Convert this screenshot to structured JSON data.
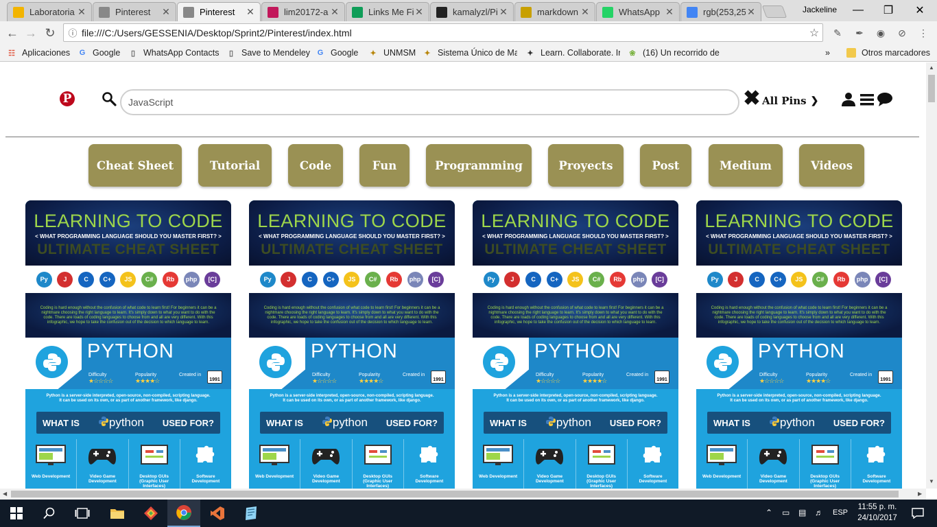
{
  "browser": {
    "tabs": [
      {
        "label": "Laboratoria",
        "icon": "laboratoria-icon",
        "color": "#f2b400"
      },
      {
        "label": "Pinterest",
        "icon": "page-icon",
        "color": "#888888"
      },
      {
        "label": "Pinterest",
        "icon": "page-icon",
        "color": "#888888",
        "active": true
      },
      {
        "label": "lim20172-a",
        "icon": "slack-icon",
        "color": "#c2185b"
      },
      {
        "label": "Links Me Fi",
        "icon": "sheets-icon",
        "color": "#0f9d58"
      },
      {
        "label": "kamalyzl/Pi",
        "icon": "github-icon",
        "color": "#222222"
      },
      {
        "label": "markdown",
        "icon": "markdown-icon",
        "color": "#c8a000"
      },
      {
        "label": "WhatsApp",
        "icon": "whatsapp-icon",
        "color": "#25d366"
      },
      {
        "label": "rgb(253,25",
        "icon": "google-icon",
        "color": "#4285f4"
      }
    ],
    "profile_name": "Jackeline",
    "url": "file:///C:/Users/GESSENIA/Desktop/Sprint2/Pinterest/index.html",
    "bookmarks": [
      {
        "label": "Aplicaciones",
        "icon": "apps-grid-icon"
      },
      {
        "label": "Google",
        "icon": "google-icon"
      },
      {
        "label": "WhatsApp Contacts",
        "icon": "page-icon"
      },
      {
        "label": "Save to Mendeley",
        "icon": "page-icon"
      },
      {
        "label": "Google",
        "icon": "google-icon"
      },
      {
        "label": "UNMSM",
        "icon": "unmsm-icon"
      },
      {
        "label": "Sistema Único de Ma",
        "icon": "unmsm-icon"
      },
      {
        "label": "Learn. Collaborate. In",
        "icon": "learn-icon"
      },
      {
        "label": "(16) Un recorrido de",
        "icon": "leaf-icon"
      }
    ],
    "bookmarks_more": "»",
    "other_bookmarks": "Otros marcadores"
  },
  "page": {
    "search_value": "JavaScript",
    "filter_label": "All Pins",
    "categories": [
      "Cheat Sheet",
      "Tutorial",
      "Code",
      "Fun",
      "Programming",
      "Proyects",
      "Post",
      "Medium",
      "Videos"
    ],
    "pin": {
      "title1": "LEARNING TO CODE",
      "title2": "< WHAT PROGRAMMING LANGUAGE SHOULD YOU MASTER FIRST? >",
      "title3": "ULTIMATE CHEAT SHEET",
      "languages": [
        {
          "name": "python",
          "label": "Py",
          "color": "#1e88c9"
        },
        {
          "name": "java",
          "label": "J",
          "color": "#d32f2f"
        },
        {
          "name": "c",
          "label": "C",
          "color": "#1565c0"
        },
        {
          "name": "cpp",
          "label": "C+",
          "color": "#1565c0"
        },
        {
          "name": "javascript",
          "label": "JS",
          "color": "#f4c21b"
        },
        {
          "name": "csharp",
          "label": "C#",
          "color": "#6ab04c"
        },
        {
          "name": "ruby",
          "label": "Rb",
          "color": "#e53935"
        },
        {
          "name": "php",
          "label": "php",
          "color": "#7a86b8"
        },
        {
          "name": "objective-c",
          "label": "[C]",
          "color": "#6a3d9a"
        }
      ],
      "intro": "Coding is hard enough without the confusion of what code to learn first! For beginners it can be a nightmare choosing the right language to learn. It's simply down to what you want to do with the code. There are loads of coding languages to choose from and all are very different. With this infographic, we hope to take the confusion out of the decision to which language to learn.",
      "language_title": "PYTHON",
      "difficulty_label": "Difficulty",
      "difficulty_stars": "★☆☆☆☆",
      "popularity_label": "Popularity",
      "popularity_stars": "★★★★☆",
      "created_label": "Created in",
      "created_year": "1991",
      "description": "Python is a server-side interpreted, open-source, non-compiled, scripting language. It can be used on its own, or as part of another framework, like django.",
      "what_is": "WHAT IS",
      "python_word": "python",
      "used_for": "USED FOR?",
      "uses": [
        "Web Development",
        "Video Game Development",
        "Desktop GUIs (Graphic User Interfaces)",
        "Software Development"
      ]
    }
  },
  "taskbar": {
    "language": "ESP",
    "time": "11:55 p. m.",
    "date": "24/10/2017"
  }
}
